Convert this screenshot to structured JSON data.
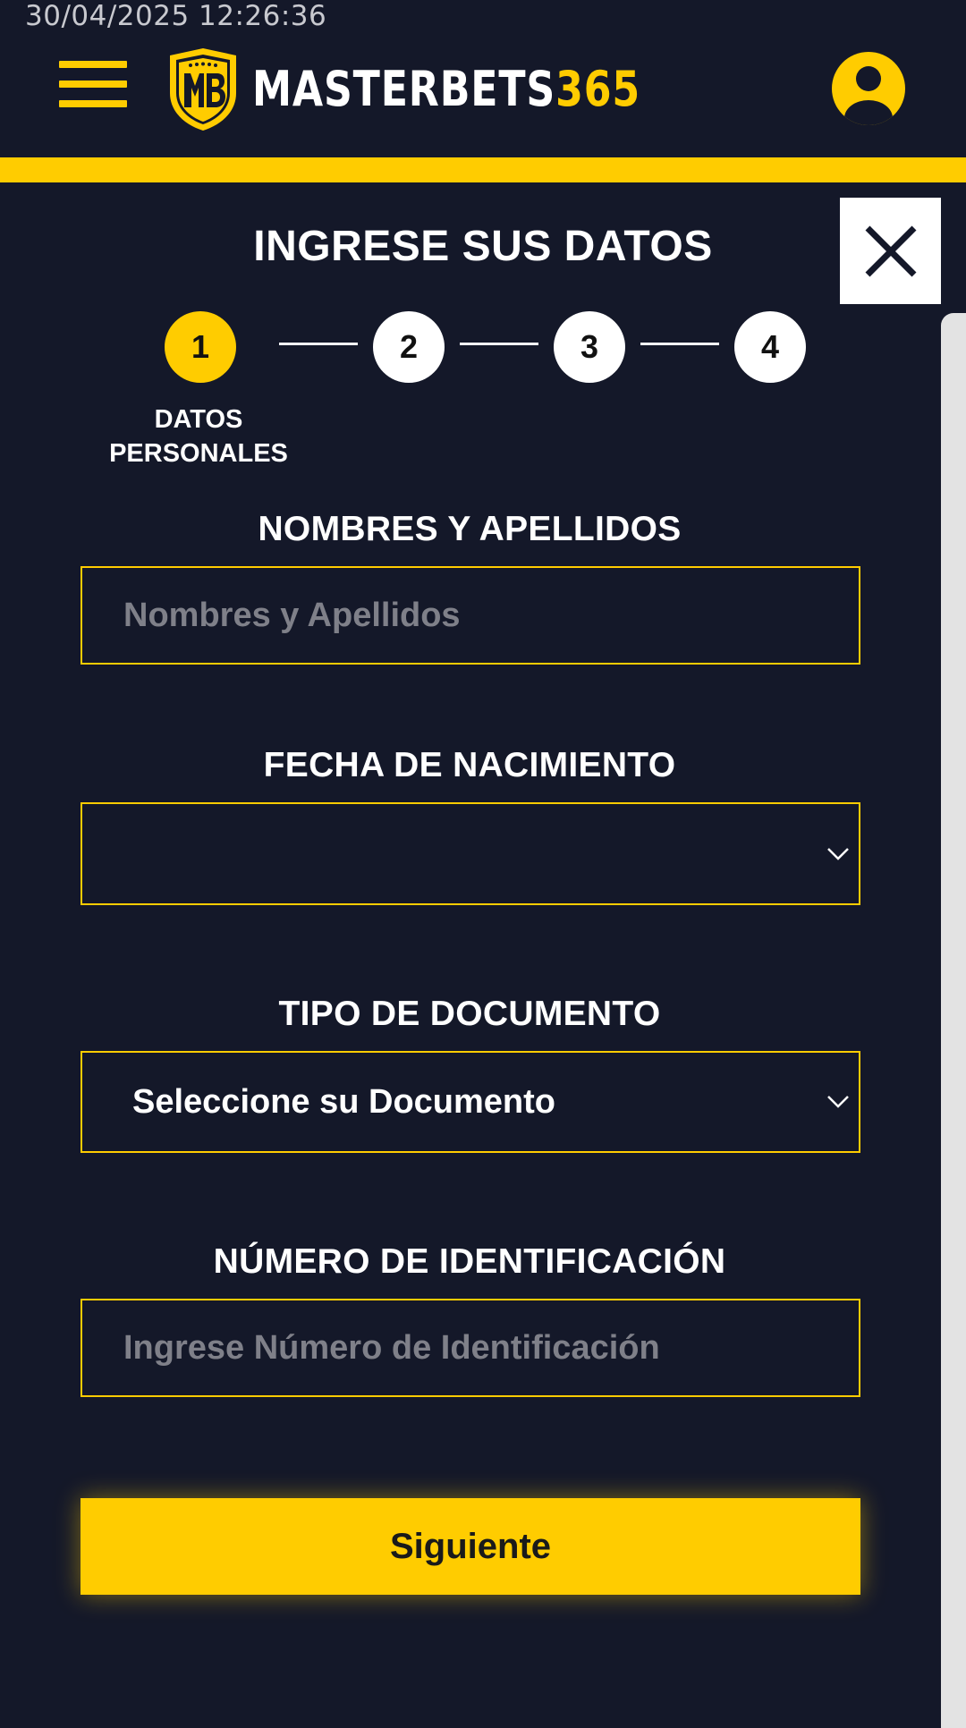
{
  "status": {
    "timestamp": "30/04/2025 12:26:36"
  },
  "header": {
    "menu_icon": "hamburger-menu-icon",
    "logo_monogram": "MB",
    "logo_text_main": "MASTERBETS",
    "logo_text_accent": "365",
    "account_icon": "user-account-icon"
  },
  "close_icon": "close-icon",
  "form": {
    "title": "INGRESE SUS DATOS",
    "steps": [
      {
        "number": "1",
        "label": "DATOS PERSONALES",
        "active": true
      },
      {
        "number": "2",
        "active": false
      },
      {
        "number": "3",
        "active": false
      },
      {
        "number": "4",
        "active": false
      }
    ],
    "step1_label_line1": "DATOS",
    "step1_label_line2": "PERSONALES",
    "fields": {
      "names": {
        "label": "NOMBRES Y APELLIDOS",
        "placeholder": "Nombres y Apellidos",
        "value": ""
      },
      "birthdate": {
        "label": "FECHA DE NACIMIENTO",
        "value": ""
      },
      "document_type": {
        "label": "TIPO DE DOCUMENTO",
        "selected": "Seleccione su Documento"
      },
      "id_number": {
        "label": "NÚMERO DE IDENTIFICACIÓN",
        "placeholder": "Ingrese Número de Identificación",
        "value": ""
      }
    },
    "next_label": "Siguiente"
  },
  "colors": {
    "background": "#141829",
    "accent": "#ffcc00",
    "white": "#ffffff",
    "placeholder": "#7f8089"
  }
}
